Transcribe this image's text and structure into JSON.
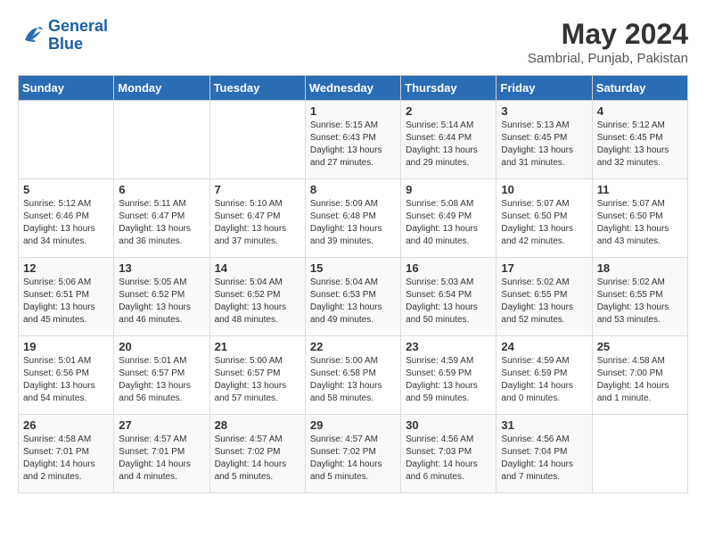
{
  "header": {
    "logo_line1": "General",
    "logo_line2": "Blue",
    "month_year": "May 2024",
    "location": "Sambrial, Punjab, Pakistan"
  },
  "days_of_week": [
    "Sunday",
    "Monday",
    "Tuesday",
    "Wednesday",
    "Thursday",
    "Friday",
    "Saturday"
  ],
  "weeks": [
    [
      {
        "day": "",
        "detail": ""
      },
      {
        "day": "",
        "detail": ""
      },
      {
        "day": "",
        "detail": ""
      },
      {
        "day": "1",
        "detail": "Sunrise: 5:15 AM\nSunset: 6:43 PM\nDaylight: 13 hours\nand 27 minutes."
      },
      {
        "day": "2",
        "detail": "Sunrise: 5:14 AM\nSunset: 6:44 PM\nDaylight: 13 hours\nand 29 minutes."
      },
      {
        "day": "3",
        "detail": "Sunrise: 5:13 AM\nSunset: 6:45 PM\nDaylight: 13 hours\nand 31 minutes."
      },
      {
        "day": "4",
        "detail": "Sunrise: 5:12 AM\nSunset: 6:45 PM\nDaylight: 13 hours\nand 32 minutes."
      }
    ],
    [
      {
        "day": "5",
        "detail": "Sunrise: 5:12 AM\nSunset: 6:46 PM\nDaylight: 13 hours\nand 34 minutes."
      },
      {
        "day": "6",
        "detail": "Sunrise: 5:11 AM\nSunset: 6:47 PM\nDaylight: 13 hours\nand 36 minutes."
      },
      {
        "day": "7",
        "detail": "Sunrise: 5:10 AM\nSunset: 6:47 PM\nDaylight: 13 hours\nand 37 minutes."
      },
      {
        "day": "8",
        "detail": "Sunrise: 5:09 AM\nSunset: 6:48 PM\nDaylight: 13 hours\nand 39 minutes."
      },
      {
        "day": "9",
        "detail": "Sunrise: 5:08 AM\nSunset: 6:49 PM\nDaylight: 13 hours\nand 40 minutes."
      },
      {
        "day": "10",
        "detail": "Sunrise: 5:07 AM\nSunset: 6:50 PM\nDaylight: 13 hours\nand 42 minutes."
      },
      {
        "day": "11",
        "detail": "Sunrise: 5:07 AM\nSunset: 6:50 PM\nDaylight: 13 hours\nand 43 minutes."
      }
    ],
    [
      {
        "day": "12",
        "detail": "Sunrise: 5:06 AM\nSunset: 6:51 PM\nDaylight: 13 hours\nand 45 minutes."
      },
      {
        "day": "13",
        "detail": "Sunrise: 5:05 AM\nSunset: 6:52 PM\nDaylight: 13 hours\nand 46 minutes."
      },
      {
        "day": "14",
        "detail": "Sunrise: 5:04 AM\nSunset: 6:52 PM\nDaylight: 13 hours\nand 48 minutes."
      },
      {
        "day": "15",
        "detail": "Sunrise: 5:04 AM\nSunset: 6:53 PM\nDaylight: 13 hours\nand 49 minutes."
      },
      {
        "day": "16",
        "detail": "Sunrise: 5:03 AM\nSunset: 6:54 PM\nDaylight: 13 hours\nand 50 minutes."
      },
      {
        "day": "17",
        "detail": "Sunrise: 5:02 AM\nSunset: 6:55 PM\nDaylight: 13 hours\nand 52 minutes."
      },
      {
        "day": "18",
        "detail": "Sunrise: 5:02 AM\nSunset: 6:55 PM\nDaylight: 13 hours\nand 53 minutes."
      }
    ],
    [
      {
        "day": "19",
        "detail": "Sunrise: 5:01 AM\nSunset: 6:56 PM\nDaylight: 13 hours\nand 54 minutes."
      },
      {
        "day": "20",
        "detail": "Sunrise: 5:01 AM\nSunset: 6:57 PM\nDaylight: 13 hours\nand 56 minutes."
      },
      {
        "day": "21",
        "detail": "Sunrise: 5:00 AM\nSunset: 6:57 PM\nDaylight: 13 hours\nand 57 minutes."
      },
      {
        "day": "22",
        "detail": "Sunrise: 5:00 AM\nSunset: 6:58 PM\nDaylight: 13 hours\nand 58 minutes."
      },
      {
        "day": "23",
        "detail": "Sunrise: 4:59 AM\nSunset: 6:59 PM\nDaylight: 13 hours\nand 59 minutes."
      },
      {
        "day": "24",
        "detail": "Sunrise: 4:59 AM\nSunset: 6:59 PM\nDaylight: 14 hours\nand 0 minutes."
      },
      {
        "day": "25",
        "detail": "Sunrise: 4:58 AM\nSunset: 7:00 PM\nDaylight: 14 hours\nand 1 minute."
      }
    ],
    [
      {
        "day": "26",
        "detail": "Sunrise: 4:58 AM\nSunset: 7:01 PM\nDaylight: 14 hours\nand 2 minutes."
      },
      {
        "day": "27",
        "detail": "Sunrise: 4:57 AM\nSunset: 7:01 PM\nDaylight: 14 hours\nand 4 minutes."
      },
      {
        "day": "28",
        "detail": "Sunrise: 4:57 AM\nSunset: 7:02 PM\nDaylight: 14 hours\nand 5 minutes."
      },
      {
        "day": "29",
        "detail": "Sunrise: 4:57 AM\nSunset: 7:02 PM\nDaylight: 14 hours\nand 5 minutes."
      },
      {
        "day": "30",
        "detail": "Sunrise: 4:56 AM\nSunset: 7:03 PM\nDaylight: 14 hours\nand 6 minutes."
      },
      {
        "day": "31",
        "detail": "Sunrise: 4:56 AM\nSunset: 7:04 PM\nDaylight: 14 hours\nand 7 minutes."
      },
      {
        "day": "",
        "detail": ""
      }
    ]
  ]
}
